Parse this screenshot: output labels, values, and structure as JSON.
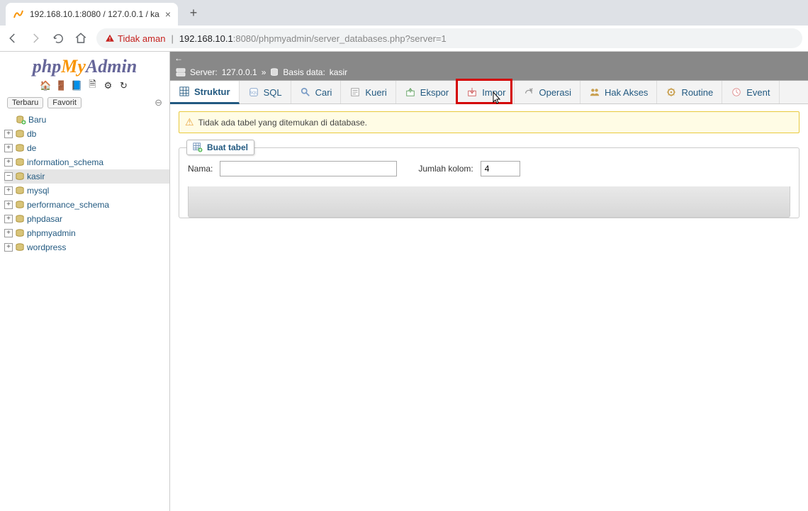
{
  "browser": {
    "tab_title": "192.168.10.1:8080 / 127.0.0.1 / ka",
    "url_warning": "Tidak aman",
    "url_host": "192.168.10.1",
    "url_port": ":8080",
    "url_path": "/phpmyadmin/server_databases.php?server=1"
  },
  "logo": {
    "php": "php",
    "my": "My",
    "admin": "Admin"
  },
  "sidebar_tabs": {
    "recent": "Terbaru",
    "favorite": "Favorit"
  },
  "tree": {
    "new": "Baru",
    "items": [
      {
        "label": "db"
      },
      {
        "label": "de"
      },
      {
        "label": "information_schema"
      },
      {
        "label": "kasir",
        "selected": true,
        "minus": true
      },
      {
        "label": "mysql"
      },
      {
        "label": "performance_schema"
      },
      {
        "label": "phpdasar"
      },
      {
        "label": "phpmyadmin"
      },
      {
        "label": "wordpress"
      }
    ]
  },
  "breadcrumb": {
    "server_label": "Server:",
    "server_value": "127.0.0.1",
    "sep": "»",
    "db_label": "Basis data:",
    "db_value": "kasir"
  },
  "tabs": [
    {
      "id": "struktur",
      "label": "Struktur",
      "active": true
    },
    {
      "id": "sql",
      "label": "SQL"
    },
    {
      "id": "cari",
      "label": "Cari"
    },
    {
      "id": "kueri",
      "label": "Kueri"
    },
    {
      "id": "ekspor",
      "label": "Ekspor"
    },
    {
      "id": "impor",
      "label": "Impor",
      "highlight": true
    },
    {
      "id": "operasi",
      "label": "Operasi"
    },
    {
      "id": "hakakses",
      "label": "Hak Akses"
    },
    {
      "id": "routine",
      "label": "Routine"
    },
    {
      "id": "event",
      "label": "Event"
    }
  ],
  "warning_text": "Tidak ada tabel yang ditemukan di database.",
  "create_table": {
    "legend": "Buat tabel",
    "name_label": "Nama:",
    "name_value": "",
    "cols_label": "Jumlah kolom:",
    "cols_value": "4"
  }
}
